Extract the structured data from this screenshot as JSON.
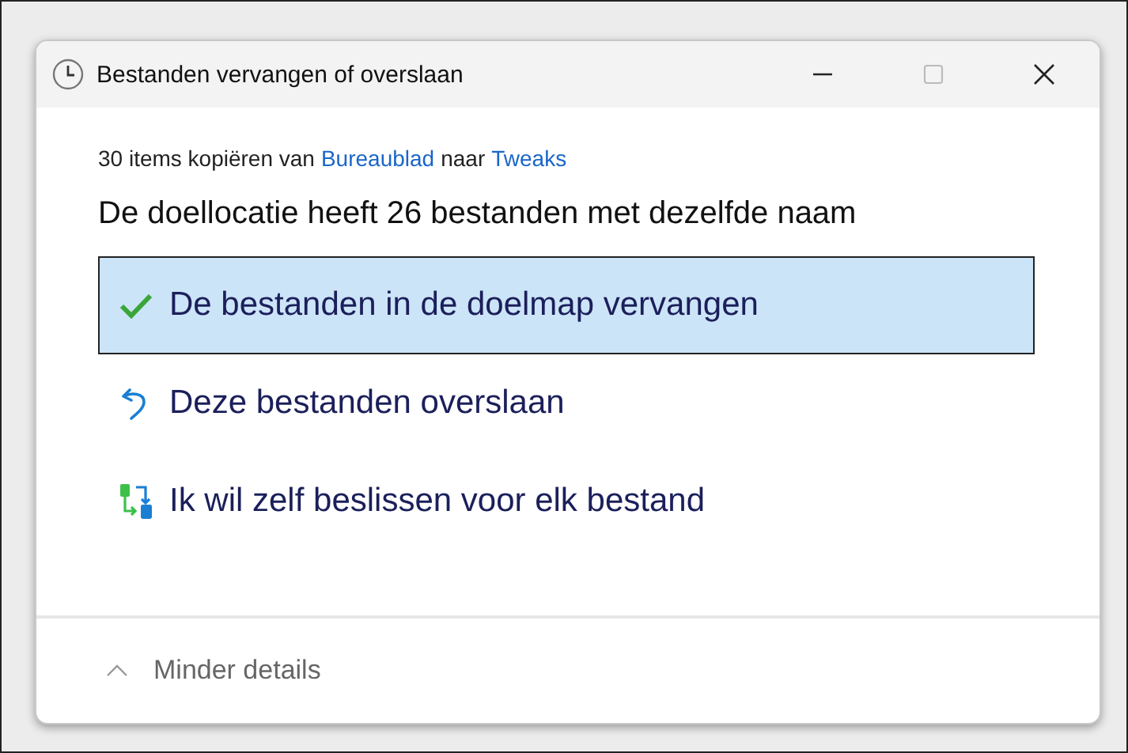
{
  "window": {
    "title": "Bestanden vervangen of overslaan"
  },
  "summary": {
    "parts": [
      {
        "kind": "text",
        "text": "30 items kopiëren van"
      },
      {
        "kind": "link",
        "text": "Bureaublad"
      },
      {
        "kind": "text",
        "text": "naar"
      },
      {
        "kind": "link",
        "text": "Tweaks"
      }
    ]
  },
  "heading": "De doellocatie heeft 26 bestanden met dezelfde naam",
  "options": [
    {
      "kind": "replace",
      "label": "De bestanden in de doelmap vervangen",
      "selected": true
    },
    {
      "kind": "skip",
      "label": "Deze bestanden overslaan",
      "selected": false
    },
    {
      "kind": "decide",
      "label": "Ik wil zelf beslissen voor elk bestand",
      "selected": false
    }
  ],
  "details_toggle": {
    "label": "Minder details",
    "expanded": true
  }
}
